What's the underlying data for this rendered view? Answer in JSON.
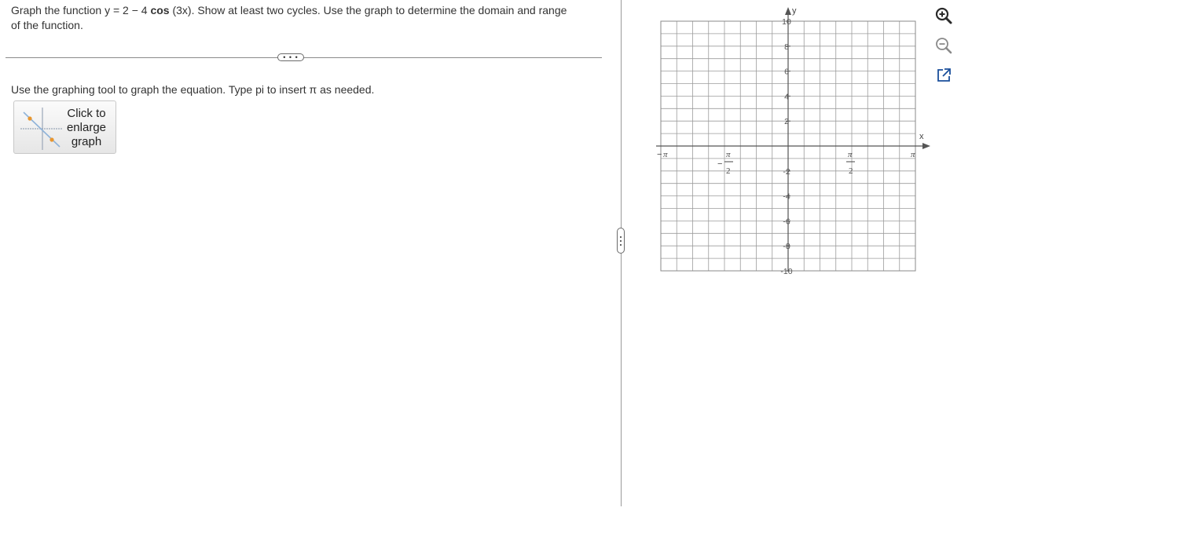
{
  "question": {
    "line1_prefix": "Graph the function y = 2 − 4 ",
    "line1_func": "cos",
    "line1_suffix": " (3x). Show at least two cycles. Use the graph to determine the domain and range",
    "line2": "of the function."
  },
  "more_button": {
    "label": "• • •"
  },
  "instruction": "Use the graphing tool to graph the equation. Type pi to insert π as needed.",
  "enlarge_button": {
    "line1": "Click to",
    "line2": "enlarge",
    "line3": "graph"
  },
  "graph": {
    "x_axis_label": "x",
    "y_axis_label": "y",
    "y_ticks": [
      "10",
      "8",
      "6",
      "4",
      "2",
      "-2",
      "-4",
      "-6",
      "-8",
      "-10"
    ],
    "x_ticks": {
      "neg_pi": "π",
      "neg_pi_sign": "−",
      "neg_half_pi_num": "π",
      "neg_half_pi_den": "2",
      "neg_half_pi_sign": "−",
      "half_pi_num": "π",
      "half_pi_den": "2",
      "pi": "π"
    },
    "x_range": [
      "-π",
      "π"
    ],
    "y_range": [
      -10,
      10
    ],
    "grid": true
  },
  "tools": {
    "zoom_in": "zoom-in-icon",
    "zoom_out": "zoom-out-icon",
    "popout": "popout-icon"
  },
  "colors": {
    "grid": "#9c9c9c",
    "axis": "#555555",
    "tool_icon": "#2a2a2a",
    "tool_icon_accent": "#1a4f9b"
  }
}
